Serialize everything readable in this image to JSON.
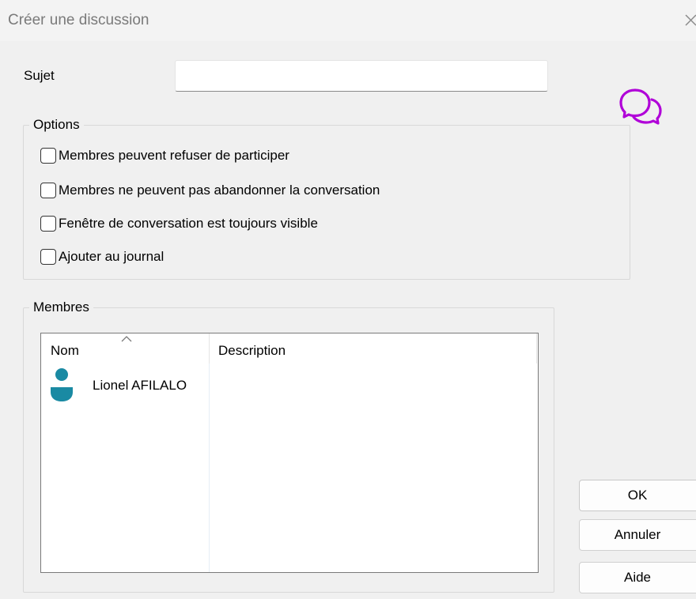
{
  "window": {
    "title": "Créer une discussion"
  },
  "subject": {
    "label": "Sujet",
    "value": ""
  },
  "options": {
    "legend": "Options",
    "items": [
      {
        "label": "Membres peuvent refuser de participer",
        "checked": false
      },
      {
        "label": "Membres ne peuvent pas abandonner la conversation",
        "checked": false
      },
      {
        "label": "Fenêtre de conversation est toujours visible",
        "checked": false
      },
      {
        "label": "Ajouter au journal",
        "checked": false
      }
    ]
  },
  "members": {
    "legend": "Membres",
    "columns": [
      "Nom",
      "Description"
    ],
    "rows": [
      {
        "name": "Lionel AFILALO",
        "description": ""
      }
    ]
  },
  "buttons": {
    "ok": "OK",
    "cancel": "Annuler",
    "help": "Aide"
  },
  "colors": {
    "chat_icon": "#b000d8",
    "user_icon": "#1a8aa3",
    "title_text": "#7a7a7a"
  },
  "icons": {
    "close": "close-icon",
    "chat": "chat-bubbles-icon",
    "user": "user-icon",
    "sort": "sort-ascending-icon"
  }
}
